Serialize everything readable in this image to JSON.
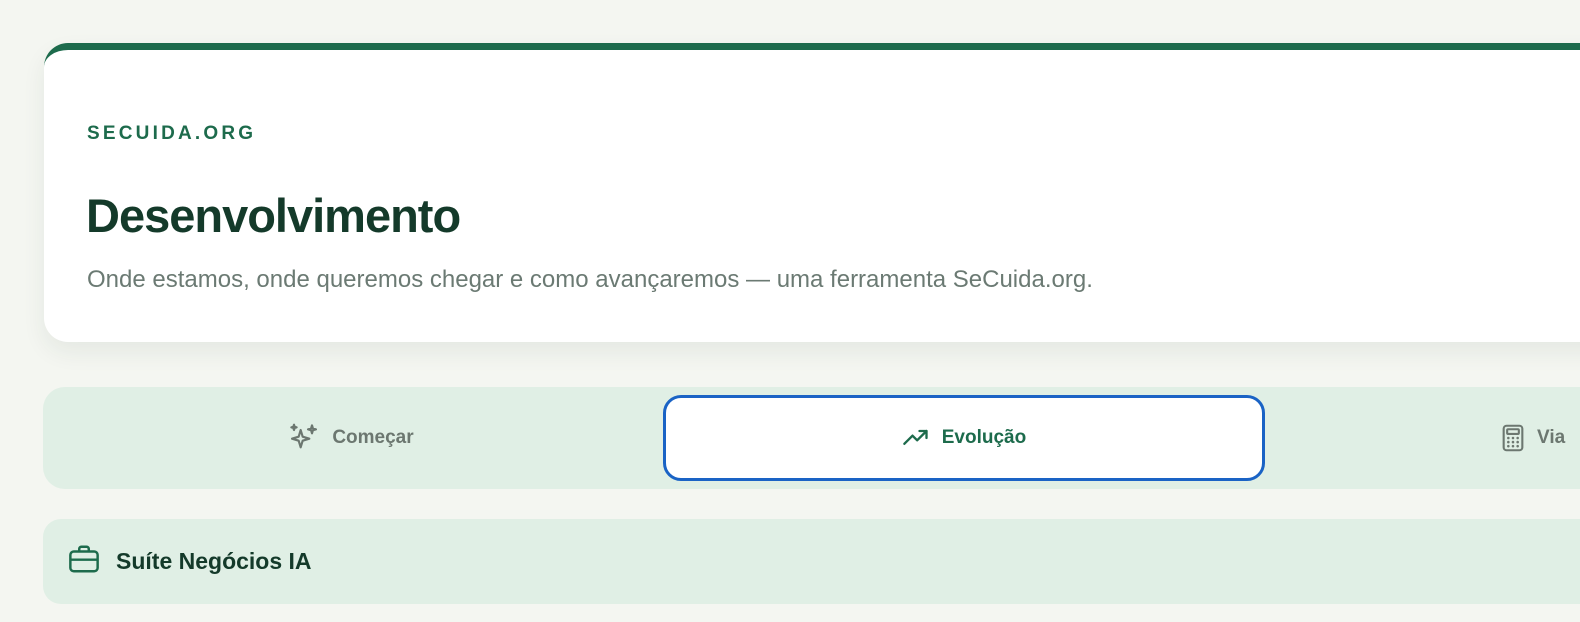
{
  "header": {
    "brand": "SECUIDA.ORG",
    "title": "Desenvolvimento",
    "subtitle": "Onde estamos, onde queremos chegar e como avançaremos — uma ferramenta SeCuida.org."
  },
  "tabs": [
    {
      "label": "Começar",
      "icon": "sparkles-icon",
      "active": false
    },
    {
      "label": "Evolução",
      "icon": "trending-up-icon",
      "active": true
    },
    {
      "label": "Via",
      "icon": "calculator-icon",
      "active": false
    }
  ],
  "suite": {
    "title": "Suíte Negócios IA",
    "icon": "briefcase-icon"
  },
  "colors": {
    "accent": "#1d6b4c",
    "focus_ring": "#1a63c5",
    "tab_bar_bg": "#e0efe5",
    "page_bg": "#f4f6f1",
    "title_text": "#143a2a",
    "muted_text": "#6b7a73"
  }
}
